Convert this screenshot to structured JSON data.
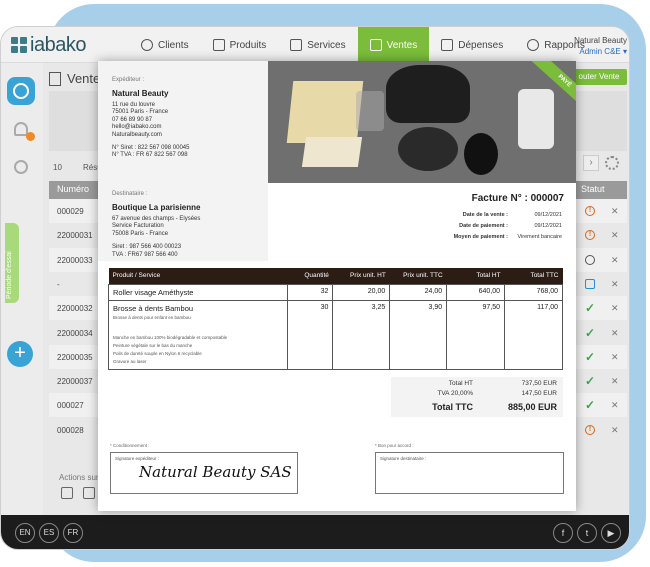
{
  "app": {
    "logo_text": "iabako"
  },
  "nav": {
    "items": [
      {
        "label": "Clients",
        "icon": "user-icon",
        "active": false
      },
      {
        "label": "Produits",
        "icon": "tag-icon",
        "active": false
      },
      {
        "label": "Services",
        "icon": "briefcase-icon",
        "active": false
      },
      {
        "label": "Ventes",
        "icon": "register-icon",
        "active": true
      },
      {
        "label": "Dépenses",
        "icon": "receipt-icon",
        "active": false
      },
      {
        "label": "Rapports",
        "icon": "chart-icon",
        "active": false
      }
    ],
    "account_name": "Natural Beauty",
    "account_role": "Admin C&E"
  },
  "sidebar": {
    "period_label": "Période d'essai"
  },
  "page": {
    "title": "Ventes",
    "new_button": "outer Vente",
    "page_size": "10",
    "page_label": "Résu",
    "columns": {
      "number": "Numéro",
      "status": "Statut"
    },
    "rows": [
      {
        "number": "000029",
        "status": "warning"
      },
      {
        "number": "22000031",
        "status": "warning"
      },
      {
        "number": "22000033",
        "status": "clock"
      },
      {
        "number": "-",
        "status": "edit"
      },
      {
        "number": "22000032",
        "status": "check"
      },
      {
        "number": "22000034",
        "status": "check"
      },
      {
        "number": "22000035",
        "status": "check"
      },
      {
        "number": "22000037",
        "status": "check"
      },
      {
        "number": "000027",
        "status": "check"
      },
      {
        "number": "000028",
        "status": "warning"
      }
    ],
    "actions_label": "Actions sur"
  },
  "footer": {
    "languages": [
      "EN",
      "ES",
      "FR"
    ],
    "social": [
      "f",
      "t",
      "yt"
    ]
  },
  "invoice": {
    "seller_label": "Expéditeur :",
    "seller_name": "Natural Beauty",
    "seller_address": [
      "11 rue du louvre",
      "75001 Paris - France",
      "07 66 89 90 87",
      "hello@iabako.com",
      "Naturalbeauty.com"
    ],
    "seller_ids": [
      "N° Siret : 822 567 098 00045",
      "N° TVA : FR 67 822 567 098"
    ],
    "badge": "PAYÉ",
    "buyer_label": "Destinataire :",
    "buyer_name": "Boutique La parisienne",
    "buyer_address": [
      "67 avenue des champs - Elysées",
      "Service Facturation",
      "75008 Paris - France"
    ],
    "buyer_ids": [
      "Siret : 987 566 400 00023",
      "TVA : FR67 987 566 400"
    ],
    "title": "Facture N° : 000007",
    "meta": [
      {
        "key": "Date de la vente :",
        "value": "09/12/2021"
      },
      {
        "key": "Date de paiement :",
        "value": "09/12/2021"
      },
      {
        "key": "Moyen de paiement :",
        "value": "Virement bancaire"
      }
    ],
    "table": {
      "headers": [
        "Produit / Service",
        "Quantité",
        "Prix unit. HT",
        "Prix unit. TTC",
        "Total HT",
        "Total TTC"
      ],
      "rows": [
        {
          "product": "Roller visage Améthyste",
          "sub": "",
          "desc": [],
          "qty": "32",
          "pu_ht": "20,00",
          "pu_ttc": "24,00",
          "total_ht": "640,00",
          "total_ttc": "768,00"
        },
        {
          "product": "Brosse à dents Bambou",
          "sub": "Brosse à dents pour enfant en bambou",
          "desc": [
            "Manche en bambou 100% biodégradable et compostable",
            "Peinture végétale sur le bas du manche",
            "Poils de dureté souple en Nylon 6 recyclable",
            "Gravure au laser"
          ],
          "qty": "30",
          "pu_ht": "3,25",
          "pu_ttc": "3,90",
          "total_ht": "97,50",
          "total_ttc": "117,00"
        }
      ]
    },
    "totals": [
      {
        "key": "Total HT",
        "value": "737,50 EUR"
      },
      {
        "key": "TVA 20,00%",
        "value": "147,50 EUR"
      },
      {
        "key": "Total TTC",
        "value": "885,00 EUR"
      }
    ],
    "conditions_label": "* Conditionnement :",
    "agreement_label": "* Bon pour accord :",
    "seller_signature_label": "Signature expéditeur :",
    "buyer_signature_label": "Signature destinataire :",
    "signature_text": "Natural Beauty SAS"
  }
}
